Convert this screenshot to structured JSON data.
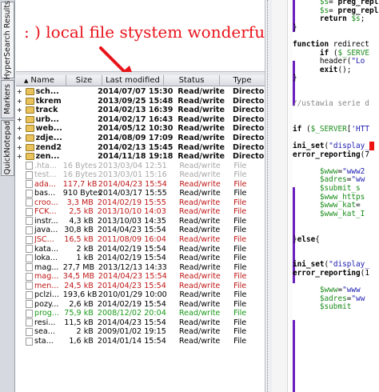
{
  "vtabs": [
    "HyperSearch Results",
    "Markers",
    "QuickNotepad"
  ],
  "caption": ": ) local file stystem wonderfull",
  "columns": [
    "Name",
    "Size",
    "Last modified",
    "Status",
    "Type"
  ],
  "sort_indicator": "▲",
  "rows": [
    {
      "name": "sch...",
      "size": "",
      "date": "2014/07/07 15:30",
      "status": "Read/write",
      "type": "Directory",
      "kind": "dir"
    },
    {
      "name": "tkrem",
      "size": "",
      "date": "2013/09/25 15:48",
      "status": "Read/write",
      "type": "Directory",
      "kind": "dir"
    },
    {
      "name": "track",
      "size": "",
      "date": "2014/02/13 16:39",
      "status": "Read/write",
      "type": "Directory",
      "kind": "dir"
    },
    {
      "name": "urb...",
      "size": "",
      "date": "2014/02/17 16:43",
      "status": "Read/write",
      "type": "Directory",
      "kind": "dir"
    },
    {
      "name": "web...",
      "size": "",
      "date": "2014/05/12 10:30",
      "status": "Read/write",
      "type": "Directory",
      "kind": "dir"
    },
    {
      "name": "zdje...",
      "size": "",
      "date": "2014/08/09 17:09",
      "status": "Read/write",
      "type": "Directory",
      "kind": "dir"
    },
    {
      "name": "zend2",
      "size": "",
      "date": "2014/02/13 15:45",
      "status": "Read/write",
      "type": "Directory",
      "kind": "dir"
    },
    {
      "name": "zen...",
      "size": "",
      "date": "2014/11/18 19:18",
      "status": "Read/write",
      "type": "Directory",
      "kind": "dir"
    },
    {
      "name": ".hta...",
      "size": "16 Bytes",
      "date": "2013/03/04 12:51",
      "status": "Read/write",
      "type": "File",
      "kind": "hidden"
    },
    {
      "name": "test...",
      "size": "16 Bytes",
      "date": "2013/03/01 15:16",
      "status": "Read/write",
      "type": "File",
      "kind": "hidden"
    },
    {
      "name": "ada...",
      "size": "117,7 kB",
      "date": "2014/04/23 15:54",
      "status": "Read/write",
      "type": "File",
      "kind": "red"
    },
    {
      "name": "bas...",
      "size": "910 Bytes",
      "date": "2014/03/17 15:55",
      "status": "Read/write",
      "type": "File",
      "kind": "normal"
    },
    {
      "name": "croo...",
      "size": "3,3 MB",
      "date": "2014/02/19 15:55",
      "status": "Read/write",
      "type": "File",
      "kind": "red"
    },
    {
      "name": "FCK...",
      "size": "2,5 kB",
      "date": "2013/10/10 14:03",
      "status": "Read/write",
      "type": "File",
      "kind": "red"
    },
    {
      "name": "instr...",
      "size": "4,3 kB",
      "date": "2013/10/03 14:35",
      "status": "Read/write",
      "type": "File",
      "kind": "normal"
    },
    {
      "name": "java...",
      "size": "30,8 kB",
      "date": "2014/04/23 15:54",
      "status": "Read/write",
      "type": "File",
      "kind": "normal"
    },
    {
      "name": "JSC...",
      "size": "16,5 kB",
      "date": "2011/08/09 16:04",
      "status": "Read/write",
      "type": "File",
      "kind": "red"
    },
    {
      "name": "kata...",
      "size": "2 kB",
      "date": "2014/02/19 15:54",
      "status": "Read/write",
      "type": "File",
      "kind": "normal"
    },
    {
      "name": "loka...",
      "size": "1 kB",
      "date": "2014/02/19 15:54",
      "status": "Read/write",
      "type": "File",
      "kind": "normal"
    },
    {
      "name": "mag...",
      "size": "27,7 MB",
      "date": "2013/12/13 14:33",
      "status": "Read/write",
      "type": "File",
      "kind": "normal"
    },
    {
      "name": "mag...",
      "size": "34,5 MB",
      "date": "2014/04/23 15:54",
      "status": "Read/write",
      "type": "File",
      "kind": "red"
    },
    {
      "name": "men...",
      "size": "24,5 kB",
      "date": "2014/04/23 15:54",
      "status": "Read/write",
      "type": "File",
      "kind": "red"
    },
    {
      "name": "pclzi...",
      "size": "193,6 kB",
      "date": "2010/01/29 10:00",
      "status": "Read/write",
      "type": "File",
      "kind": "normal"
    },
    {
      "name": "pozy...",
      "size": "2,6 kB",
      "date": "2014/02/19 15:54",
      "status": "Read/write",
      "type": "File",
      "kind": "normal"
    },
    {
      "name": "prog...",
      "size": "75,9 kB",
      "date": "2008/12/02 20:04",
      "status": "Read/write",
      "type": "File",
      "kind": "green"
    },
    {
      "name": "resi...",
      "size": "11,5 kB",
      "date": "2014/04/23 15:54",
      "status": "Read/write",
      "type": "File",
      "kind": "normal"
    },
    {
      "name": "sea...",
      "size": "2 kB",
      "date": "2009/01/02 19:15",
      "status": "Read/write",
      "type": "File",
      "kind": "normal"
    },
    {
      "name": "sta...",
      "size": "1,6 kB",
      "date": "2014/01/14 15:54",
      "status": "Read/write",
      "type": "File",
      "kind": "normal"
    }
  ],
  "editor": {
    "lines": [
      {
        "n": "",
        "html": "      <span class='var'>$s</span>= <span class='kw'>preg_repl</span>"
      },
      {
        "n": "",
        "html": "      <span class='var'>$s</span>= <span class='kw'>preg_repl</span>"
      },
      {
        "n": "",
        "html": "      <span class='kw'>return</span> <span class='var'>$s</span>;"
      },
      {
        "n": "",
        "html": "}"
      },
      {
        "n": "",
        "html": ""
      },
      {
        "n": "",
        "html": "<span class='kw'>function</span> redirect"
      },
      {
        "n": "",
        "html": "      <span class='kw'>if</span> (<span class='var'>$_SERVE</span>"
      },
      {
        "n": "",
        "html": "      header(<span class='str'>\"Lo</span>"
      },
      {
        "n": "",
        "html": "      <span class='kw'>exit</span>();"
      },
      {
        "n": "",
        "html": "}"
      },
      {
        "n": "",
        "html": ""
      },
      {
        "n": "",
        "html": ""
      },
      {
        "n": "",
        "html": "<span class='cmt'>//ustawia serie d</span>"
      },
      {
        "n": "",
        "html": ""
      },
      {
        "n": "",
        "html": ""
      },
      {
        "n": "",
        "html": "<span class='kw'>if</span> (<span class='var'>$_SERVER</span>[<span class='str'>'HTT</span>"
      },
      {
        "n": "",
        "html": ""
      },
      {
        "n": "",
        "html": "<span class='kw'>ini_set</span>(<span class='str'>\"display_</span><span class='red-mark'>&nbsp;</span>"
      },
      {
        "n": "",
        "html": "<span class='kw'>error_reporting</span>(7"
      },
      {
        "n": "",
        "html": ""
      },
      {
        "n": "",
        "html": "      <span class='var'>$www</span>=<span class='str'>\"www2</span>"
      },
      {
        "n": "",
        "html": "      <span class='var'>$adres</span>=<span class='str'>\"ww</span>"
      },
      {
        "n": "",
        "html": "      <span class='var'>$submit_s</span>"
      },
      {
        "n": "",
        "html": "      <span class='var'>$www_https</span>"
      },
      {
        "n": "",
        "html": "      <span class='var'>$www_kat</span>="
      },
      {
        "n": "",
        "html": "      <span class='var'>$www_kat_I</span>"
      },
      {
        "n": "",
        "html": ""
      },
      {
        "n": "",
        "html": ""
      },
      {
        "n": "",
        "html": "}<span class='kw'>else</span>{"
      },
      {
        "n": "",
        "html": ""
      },
      {
        "n": "",
        "html": ""
      },
      {
        "n": "",
        "html": "<span class='kw'>ini_set</span>(<span class='str'>\"display_</span>"
      },
      {
        "n": "",
        "html": "<span class='kw'>error_reporting</span>(1"
      },
      {
        "n": "",
        "html": ""
      },
      {
        "n": "",
        "html": "      <span class='var'>$www</span>=<span class='str'>\"www</span>"
      },
      {
        "n": "",
        "html": "      <span class='var'>$adres</span>=<span class='str'>\"ww</span>"
      },
      {
        "n": "",
        "html": "      <span class='var'>$submit</span>"
      },
      {
        "n": "",
        "html": ""
      },
      {
        "n": "",
        "html": ""
      },
      {
        "n": "",
        "html": ""
      },
      {
        "n": "",
        "html": ""
      },
      {
        "n": "",
        "html": ""
      },
      {
        "n": "",
        "html": ""
      },
      {
        "n": "",
        "html": ""
      },
      {
        "n": "",
        "html": ""
      },
      {
        "n": "",
        "html": ""
      },
      {
        "n": "",
        "html": ""
      }
    ],
    "numbers": [
      "",
      "",
      "",
      "",
      "",
      "",
      "",
      "",
      "",
      "",
      "",
      "",
      "",
      "",
      "",
      "",
      "",
      "",
      "",
      "",
      "",
      "",
      "",
      "",
      "",
      "",
      "",
      "",
      "",
      "",
      "",
      "",
      "",
      "",
      "",
      "",
      "",
      "",
      "",
      "",
      "",
      "",
      "",
      "",
      "",
      "",
      ""
    ]
  }
}
